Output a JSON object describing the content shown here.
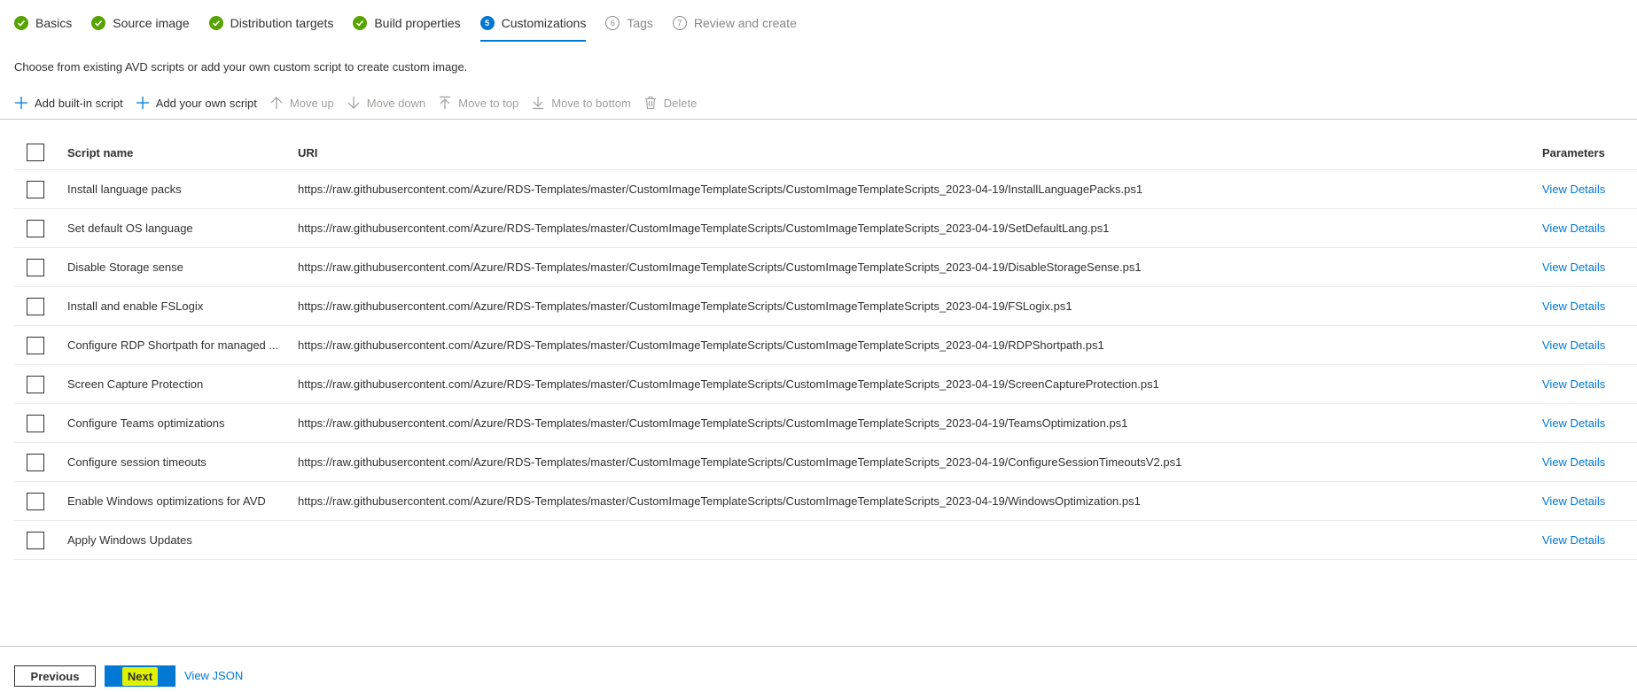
{
  "tabs": [
    {
      "label": "Basics",
      "state": "done"
    },
    {
      "label": "Source image",
      "state": "done"
    },
    {
      "label": "Distribution targets",
      "state": "done"
    },
    {
      "label": "Build properties",
      "state": "done"
    },
    {
      "label": "Customizations",
      "state": "active",
      "number": "5"
    },
    {
      "label": "Tags",
      "state": "pending",
      "number": "6"
    },
    {
      "label": "Review and create",
      "state": "pending",
      "number": "7"
    }
  ],
  "description": "Choose from existing AVD scripts or add your own custom script to create custom image.",
  "toolbar": {
    "add_builtin": "Add built-in script",
    "add_own": "Add your own script",
    "move_up": "Move up",
    "move_down": "Move down",
    "move_top": "Move to top",
    "move_bottom": "Move to bottom",
    "delete": "Delete"
  },
  "table": {
    "headers": {
      "name": "Script name",
      "uri": "URI",
      "params": "Parameters"
    },
    "rows": [
      {
        "name": "Install language packs",
        "uri": "https://raw.githubusercontent.com/Azure/RDS-Templates/master/CustomImageTemplateScripts/CustomImageTemplateScripts_2023-04-19/InstallLanguagePacks.ps1",
        "params": "View Details"
      },
      {
        "name": "Set default OS language",
        "uri": "https://raw.githubusercontent.com/Azure/RDS-Templates/master/CustomImageTemplateScripts/CustomImageTemplateScripts_2023-04-19/SetDefaultLang.ps1",
        "params": "View Details"
      },
      {
        "name": "Disable Storage sense",
        "uri": "https://raw.githubusercontent.com/Azure/RDS-Templates/master/CustomImageTemplateScripts/CustomImageTemplateScripts_2023-04-19/DisableStorageSense.ps1",
        "params": "View Details"
      },
      {
        "name": "Install and enable FSLogix",
        "uri": "https://raw.githubusercontent.com/Azure/RDS-Templates/master/CustomImageTemplateScripts/CustomImageTemplateScripts_2023-04-19/FSLogix.ps1",
        "params": "View Details"
      },
      {
        "name": "Configure RDP Shortpath for managed ...",
        "uri": "https://raw.githubusercontent.com/Azure/RDS-Templates/master/CustomImageTemplateScripts/CustomImageTemplateScripts_2023-04-19/RDPShortpath.ps1",
        "params": "View Details"
      },
      {
        "name": "Screen Capture Protection",
        "uri": "https://raw.githubusercontent.com/Azure/RDS-Templates/master/CustomImageTemplateScripts/CustomImageTemplateScripts_2023-04-19/ScreenCaptureProtection.ps1",
        "params": "View Details"
      },
      {
        "name": "Configure Teams optimizations",
        "uri": "https://raw.githubusercontent.com/Azure/RDS-Templates/master/CustomImageTemplateScripts/CustomImageTemplateScripts_2023-04-19/TeamsOptimization.ps1",
        "params": "View Details"
      },
      {
        "name": "Configure session timeouts",
        "uri": "https://raw.githubusercontent.com/Azure/RDS-Templates/master/CustomImageTemplateScripts/CustomImageTemplateScripts_2023-04-19/ConfigureSessionTimeoutsV2.ps1",
        "params": "View Details"
      },
      {
        "name": "Enable Windows optimizations for AVD",
        "uri": "https://raw.githubusercontent.com/Azure/RDS-Templates/master/CustomImageTemplateScripts/CustomImageTemplateScripts_2023-04-19/WindowsOptimization.ps1",
        "params": "View Details"
      },
      {
        "name": "Apply Windows Updates",
        "uri": "",
        "params": "View Details"
      }
    ]
  },
  "footer": {
    "previous": "Previous",
    "next": "Next",
    "view_json": "View JSON"
  },
  "colors": {
    "accent": "#0078d4",
    "success": "#57a300",
    "highlight": "#dff200"
  }
}
